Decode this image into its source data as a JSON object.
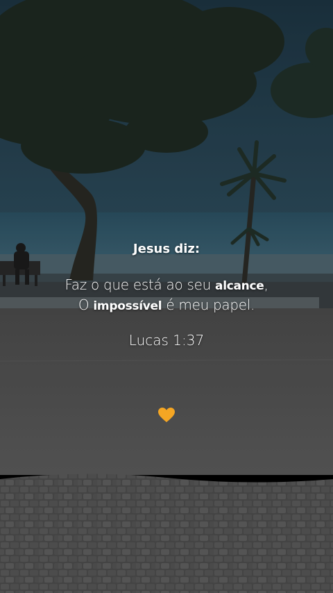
{
  "caption": {
    "title": "Jesus diz:",
    "line1_prefix": "Faz o que está ao seu ",
    "line1_bold": "alcance",
    "line1_suffix": ",",
    "line2_prefix": "O ",
    "line2_bold": "impossível",
    "line2_suffix": " é meu papel.",
    "reference": "Lucas 1:37"
  },
  "heart": {
    "icon": "orange-heart-icon",
    "color": "#f5a623"
  },
  "colors": {
    "sky": "#1f3a4a",
    "sea": "#2f5566",
    "ground": "#575757",
    "cobble": "#4a4a4a"
  }
}
